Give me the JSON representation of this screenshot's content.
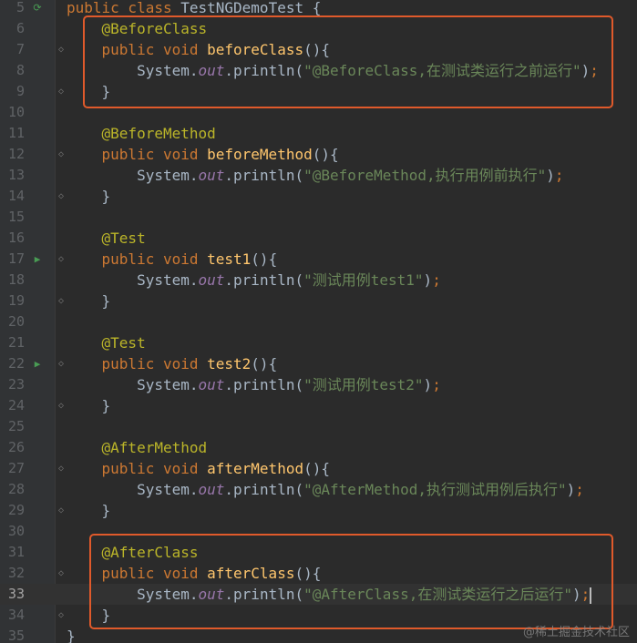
{
  "lines": [
    {
      "no": "5",
      "tokens": [
        {
          "t": "kw",
          "v": "public class "
        },
        {
          "t": "plain",
          "v": "TestNGDemoTest {"
        }
      ]
    },
    {
      "no": "6",
      "tokens": [
        {
          "t": "plain",
          "v": "    "
        },
        {
          "t": "ann",
          "v": "@BeforeClass"
        }
      ]
    },
    {
      "no": "7",
      "tokens": [
        {
          "t": "plain",
          "v": "    "
        },
        {
          "t": "kw",
          "v": "public void "
        },
        {
          "t": "fn",
          "v": "beforeClass"
        },
        {
          "t": "plain",
          "v": "(){"
        }
      ]
    },
    {
      "no": "8",
      "tokens": [
        {
          "t": "plain",
          "v": "        System."
        },
        {
          "t": "field",
          "v": "out"
        },
        {
          "t": "plain",
          "v": ".println("
        },
        {
          "t": "str",
          "v": "\"@BeforeClass,在测试类运行之前运行\""
        },
        {
          "t": "plain",
          "v": ")"
        },
        {
          "t": "kw",
          "v": ";"
        }
      ]
    },
    {
      "no": "9",
      "tokens": [
        {
          "t": "plain",
          "v": "    }"
        }
      ]
    },
    {
      "no": "10",
      "tokens": []
    },
    {
      "no": "11",
      "tokens": [
        {
          "t": "plain",
          "v": "    "
        },
        {
          "t": "ann",
          "v": "@BeforeMethod"
        }
      ]
    },
    {
      "no": "12",
      "tokens": [
        {
          "t": "plain",
          "v": "    "
        },
        {
          "t": "kw",
          "v": "public void "
        },
        {
          "t": "fn",
          "v": "beforeMethod"
        },
        {
          "t": "plain",
          "v": "(){"
        }
      ]
    },
    {
      "no": "13",
      "tokens": [
        {
          "t": "plain",
          "v": "        System."
        },
        {
          "t": "field",
          "v": "out"
        },
        {
          "t": "plain",
          "v": ".println("
        },
        {
          "t": "str",
          "v": "\"@BeforeMethod,执行用例前执行\""
        },
        {
          "t": "plain",
          "v": ")"
        },
        {
          "t": "kw",
          "v": ";"
        }
      ]
    },
    {
      "no": "14",
      "tokens": [
        {
          "t": "plain",
          "v": "    }"
        }
      ]
    },
    {
      "no": "15",
      "tokens": []
    },
    {
      "no": "16",
      "tokens": [
        {
          "t": "plain",
          "v": "    "
        },
        {
          "t": "ann",
          "v": "@Test"
        }
      ]
    },
    {
      "no": "17",
      "tokens": [
        {
          "t": "plain",
          "v": "    "
        },
        {
          "t": "kw",
          "v": "public void "
        },
        {
          "t": "fn",
          "v": "test1"
        },
        {
          "t": "plain",
          "v": "(){"
        }
      ]
    },
    {
      "no": "18",
      "tokens": [
        {
          "t": "plain",
          "v": "        System."
        },
        {
          "t": "field",
          "v": "out"
        },
        {
          "t": "plain",
          "v": ".println("
        },
        {
          "t": "str",
          "v": "\"测试用例test1\""
        },
        {
          "t": "plain",
          "v": ")"
        },
        {
          "t": "kw",
          "v": ";"
        }
      ]
    },
    {
      "no": "19",
      "tokens": [
        {
          "t": "plain",
          "v": "    }"
        }
      ]
    },
    {
      "no": "20",
      "tokens": []
    },
    {
      "no": "21",
      "tokens": [
        {
          "t": "plain",
          "v": "    "
        },
        {
          "t": "ann",
          "v": "@Test"
        }
      ]
    },
    {
      "no": "22",
      "tokens": [
        {
          "t": "plain",
          "v": "    "
        },
        {
          "t": "kw",
          "v": "public void "
        },
        {
          "t": "fn",
          "v": "test2"
        },
        {
          "t": "plain",
          "v": "(){"
        }
      ]
    },
    {
      "no": "23",
      "tokens": [
        {
          "t": "plain",
          "v": "        System."
        },
        {
          "t": "field",
          "v": "out"
        },
        {
          "t": "plain",
          "v": ".println("
        },
        {
          "t": "str",
          "v": "\"测试用例test2\""
        },
        {
          "t": "plain",
          "v": ")"
        },
        {
          "t": "kw",
          "v": ";"
        }
      ]
    },
    {
      "no": "24",
      "tokens": [
        {
          "t": "plain",
          "v": "    }"
        }
      ]
    },
    {
      "no": "25",
      "tokens": []
    },
    {
      "no": "26",
      "tokens": [
        {
          "t": "plain",
          "v": "    "
        },
        {
          "t": "ann",
          "v": "@AfterMethod"
        }
      ]
    },
    {
      "no": "27",
      "tokens": [
        {
          "t": "plain",
          "v": "    "
        },
        {
          "t": "kw",
          "v": "public void "
        },
        {
          "t": "fn",
          "v": "afterMethod"
        },
        {
          "t": "plain",
          "v": "(){"
        }
      ]
    },
    {
      "no": "28",
      "tokens": [
        {
          "t": "plain",
          "v": "        System."
        },
        {
          "t": "field",
          "v": "out"
        },
        {
          "t": "plain",
          "v": ".println("
        },
        {
          "t": "str",
          "v": "\"@AfterMethod,执行测试用例后执行\""
        },
        {
          "t": "plain",
          "v": ")"
        },
        {
          "t": "kw",
          "v": ";"
        }
      ]
    },
    {
      "no": "29",
      "tokens": [
        {
          "t": "plain",
          "v": "    }"
        }
      ]
    },
    {
      "no": "30",
      "tokens": []
    },
    {
      "no": "31",
      "tokens": [
        {
          "t": "plain",
          "v": "    "
        },
        {
          "t": "ann",
          "v": "@AfterClass"
        }
      ]
    },
    {
      "no": "32",
      "tokens": [
        {
          "t": "plain",
          "v": "    "
        },
        {
          "t": "kw",
          "v": "public void "
        },
        {
          "t": "fn",
          "v": "afterClass"
        },
        {
          "t": "plain",
          "v": "(){"
        }
      ]
    },
    {
      "no": "33",
      "tokens": [
        {
          "t": "plain",
          "v": "        System."
        },
        {
          "t": "field",
          "v": "out"
        },
        {
          "t": "plain",
          "v": ".println("
        },
        {
          "t": "str",
          "v": "\"@AfterClass,在测试类运行之后运行\""
        },
        {
          "t": "plain",
          "v": ")"
        },
        {
          "t": "kw",
          "v": ";"
        }
      ],
      "current": true
    },
    {
      "no": "34",
      "tokens": [
        {
          "t": "plain",
          "v": "    }"
        }
      ]
    },
    {
      "no": "35",
      "tokens": [
        {
          "t": "plain",
          "v": "}"
        }
      ]
    }
  ],
  "gutter_icons": {
    "5": "run-class-icon",
    "17": "run-test-icon",
    "22": "run-test-icon"
  },
  "fold_icons": [
    "7",
    "9",
    "12",
    "14",
    "17",
    "19",
    "22",
    "24",
    "27",
    "29",
    "32",
    "34"
  ],
  "watermark": "@稀土掘金技术社区",
  "colors": {
    "background": "#2b2b2b",
    "gutter": "#313335",
    "keyword": "#cc7832",
    "annotation": "#bbb529",
    "method": "#ffc66d",
    "field": "#9876aa",
    "string": "#6a8759",
    "plain": "#a9b7c6",
    "highlight_box": "#e05a2b",
    "run_icon": "#499c54"
  }
}
